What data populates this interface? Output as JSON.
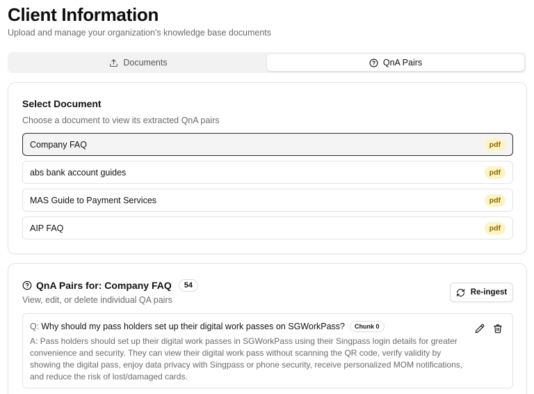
{
  "page": {
    "title": "Client Information",
    "subtitle": "Upload and manage your organization's knowledge base documents"
  },
  "tabs": [
    {
      "label": "Documents",
      "icon": "upload-icon",
      "active": false
    },
    {
      "label": "QnA Pairs",
      "icon": "help-circle-icon",
      "active": true
    }
  ],
  "select_document": {
    "title": "Select Document",
    "description": "Choose a document to view its extracted QnA pairs",
    "documents": [
      {
        "name": "Company FAQ",
        "type": "pdf",
        "selected": true
      },
      {
        "name": "abs bank account guides",
        "type": "pdf",
        "selected": false
      },
      {
        "name": "MAS Guide to Payment Services",
        "type": "pdf",
        "selected": false
      },
      {
        "name": "AIP FAQ",
        "type": "pdf",
        "selected": false
      }
    ]
  },
  "qna_section": {
    "title": "QnA Pairs for: Company FAQ",
    "count": "54",
    "description": "View, edit, or delete individual QA pairs",
    "reingest_label": "Re-ingest",
    "pairs": [
      {
        "q_prefix": "Q:",
        "question": "Why should my pass holders set up their digital work passes on SGWorkPass?",
        "chunk": "Chunk 0",
        "answer": "A: Pass holders should set up their digital work passes in SGWorkPass using their Singpass login details for greater convenience and security. They can view their digital work pass without scanning the QR code, verify validity by showing the digital pass, enjoy data privacy with Singpass or phone security, receive personalized MOM notifications, and reduce the risk of lost/damaged cards."
      }
    ]
  },
  "colors": {
    "pdf_badge_bg": "#fdf3c4",
    "pdf_badge_text": "#8a6a00",
    "selected_border": "#2b2b2b"
  }
}
